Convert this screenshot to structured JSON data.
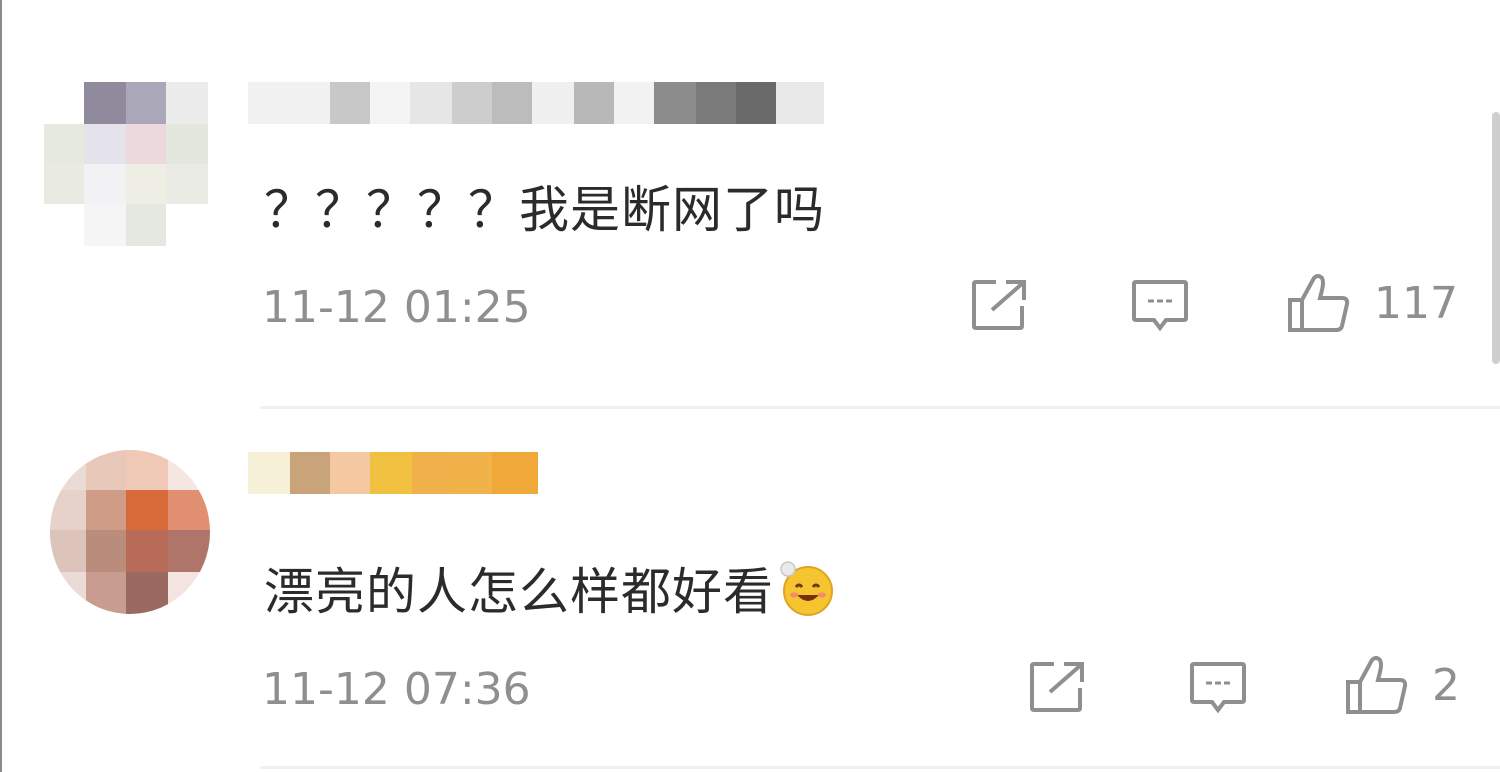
{
  "comments": [
    {
      "text": "？？？？？我是断网了吗",
      "time": "11-12 01:25",
      "like_count": "117"
    },
    {
      "text": "漂亮的人怎么样都好看",
      "time": "11-12 07:36",
      "like_count": "2",
      "emoji": "smiling-emoji"
    }
  ],
  "icons": {
    "share": "share-icon",
    "reply": "comment-icon",
    "like": "thumbs-up-icon"
  },
  "colors": {
    "text": "#2b2b2b",
    "meta": "#8f8f8f",
    "icon": "#8f8f8f",
    "divider": "#f0f0f0"
  }
}
